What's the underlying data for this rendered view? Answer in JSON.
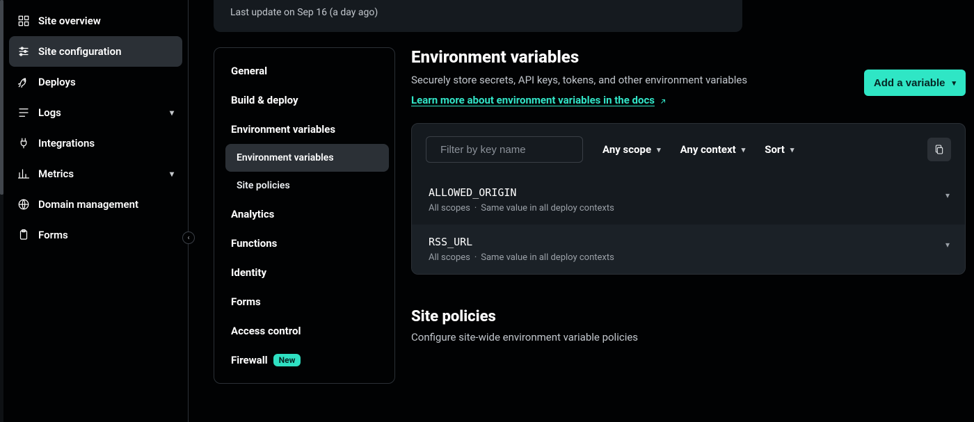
{
  "banner": {
    "last_update": "Last update on Sep 16 (a day ago)"
  },
  "sidebar": {
    "items": [
      {
        "label": "Site overview"
      },
      {
        "label": "Site configuration"
      },
      {
        "label": "Deploys"
      },
      {
        "label": "Logs"
      },
      {
        "label": "Integrations"
      },
      {
        "label": "Metrics"
      },
      {
        "label": "Domain management"
      },
      {
        "label": "Forms"
      }
    ]
  },
  "config_nav": {
    "items": [
      {
        "label": "General"
      },
      {
        "label": "Build & deploy"
      },
      {
        "label": "Environment variables"
      },
      {
        "label": "Analytics"
      },
      {
        "label": "Functions"
      },
      {
        "label": "Identity"
      },
      {
        "label": "Forms"
      },
      {
        "label": "Access control"
      },
      {
        "label": "Firewall"
      }
    ],
    "sub": [
      {
        "label": "Environment variables"
      },
      {
        "label": "Site policies"
      }
    ],
    "new_badge": "New"
  },
  "env": {
    "title": "Environment variables",
    "subtitle": "Securely store secrets, API keys, tokens, and other environment variables",
    "learn_more": "Learn more about environment variables in the docs",
    "add_button": "Add a variable",
    "filter_placeholder": "Filter by key name",
    "scope_label": "Any scope",
    "context_label": "Any context",
    "sort_label": "Sort",
    "vars": [
      {
        "key": "ALLOWED_ORIGIN",
        "scope": "All scopes",
        "context": "Same value in all deploy contexts"
      },
      {
        "key": "RSS_URL",
        "scope": "All scopes",
        "context": "Same value in all deploy contexts"
      }
    ]
  },
  "policies": {
    "title": "Site policies",
    "subtitle": "Configure site-wide environment variable policies"
  }
}
